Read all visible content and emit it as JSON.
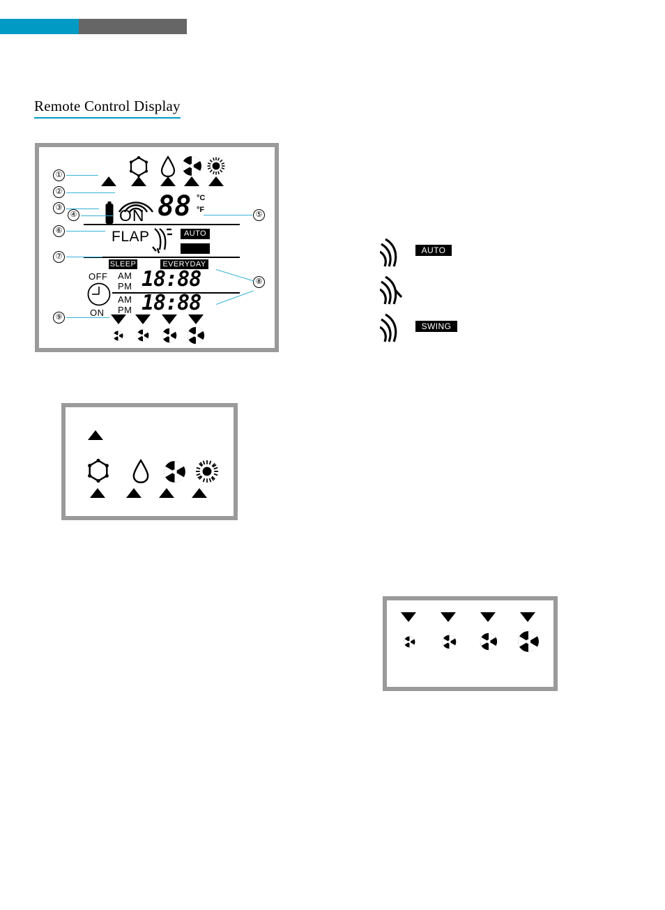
{
  "header": {
    "bar_cyan_color": "#009ac4",
    "bar_gray_color": "#666666"
  },
  "page_title": "Remote Control Display",
  "lcd": {
    "mode_icons": [
      {
        "name": "snowflake-icon",
        "meaning": "cool"
      },
      {
        "name": "water-drop-icon",
        "meaning": "dry"
      },
      {
        "name": "fan-icon",
        "meaning": "fan"
      },
      {
        "name": "sun-icon",
        "meaning": "heat"
      }
    ],
    "on_label": "ON",
    "temperature_value": "88",
    "unit_celsius": "°C",
    "unit_fahrenheit": "°F",
    "flap_label": "FLAP",
    "auto_badge": "AUTO",
    "sleep_badge": "SLEEP",
    "everyday_badge": "EVERYDAY",
    "timer_off_label": "OFF",
    "timer_on_label": "ON",
    "am_label": "AM",
    "pm_label": "PM",
    "timer_off_time": "18:88",
    "timer_on_time": "18:88"
  },
  "callouts": [
    {
      "id": "1",
      "number": "①"
    },
    {
      "id": "2",
      "number": "②"
    },
    {
      "id": "3",
      "number": "③"
    },
    {
      "id": "4",
      "number": "④"
    },
    {
      "id": "5",
      "number": "⑤"
    },
    {
      "id": "6",
      "number": "⑥"
    },
    {
      "id": "7",
      "number": "⑦"
    },
    {
      "id": "8",
      "number": "⑧"
    },
    {
      "id": "9",
      "number": "⑨"
    }
  ],
  "swing_legend": [
    {
      "icon": "swing-waves-icon",
      "badge": "AUTO"
    },
    {
      "icon": "swing-waves-icon",
      "badge": ""
    },
    {
      "icon": "swing-waves-icon",
      "badge": "SWING"
    }
  ],
  "mode_legend": {
    "standalone_triangle": "auto-mode-pointer",
    "icons": [
      {
        "name": "snowflake-icon"
      },
      {
        "name": "water-drop-icon"
      },
      {
        "name": "fan-icon"
      },
      {
        "name": "sun-icon"
      }
    ]
  },
  "fan_legend": {
    "levels": [
      {
        "name": "fan-speed-1"
      },
      {
        "name": "fan-speed-2"
      },
      {
        "name": "fan-speed-3"
      },
      {
        "name": "fan-speed-4"
      }
    ]
  }
}
